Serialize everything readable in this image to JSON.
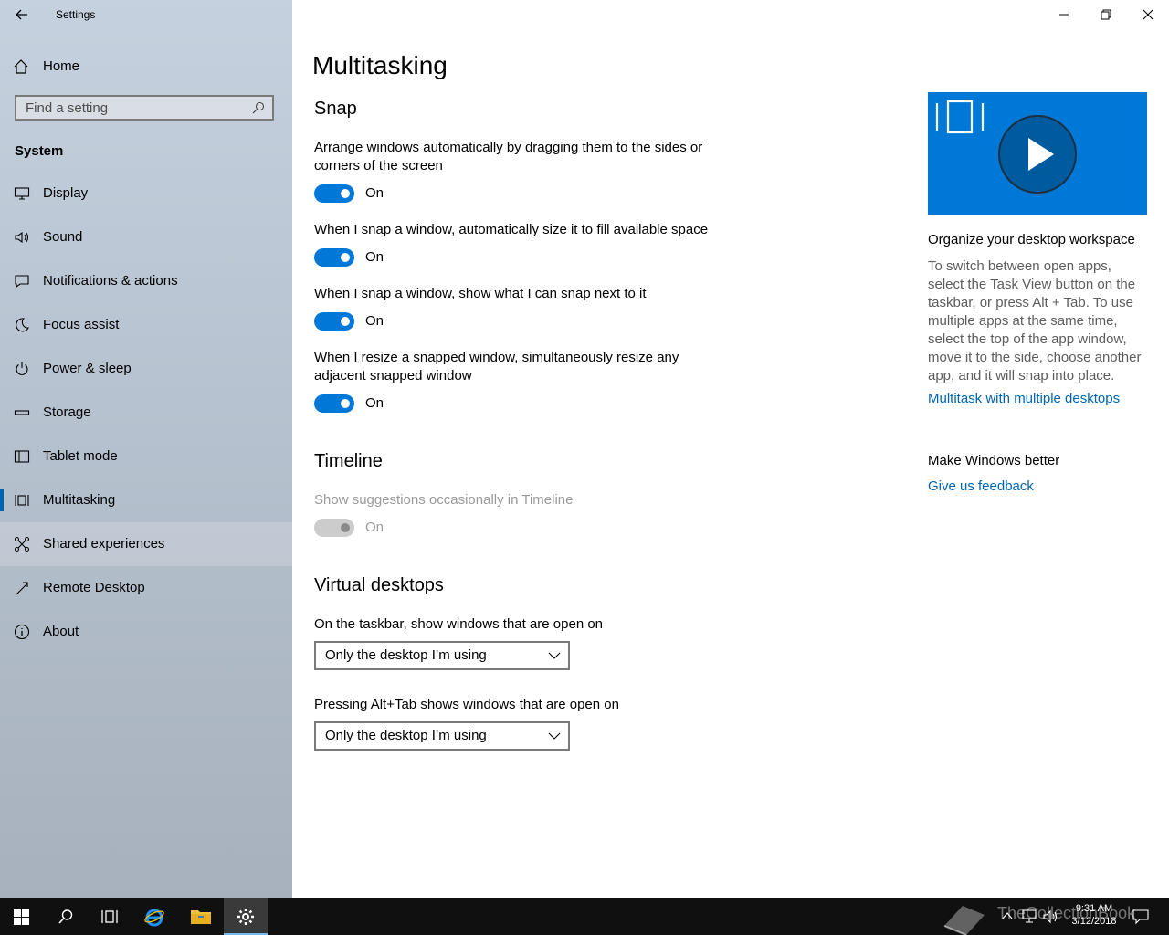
{
  "app": {
    "title": "Settings"
  },
  "sidebar": {
    "home_label": "Home",
    "search_placeholder": "Find a setting",
    "section": "System",
    "items": [
      {
        "label": "Display",
        "icon": "monitor-icon"
      },
      {
        "label": "Sound",
        "icon": "speaker-icon"
      },
      {
        "label": "Notifications & actions",
        "icon": "message-icon"
      },
      {
        "label": "Focus assist",
        "icon": "moon-icon"
      },
      {
        "label": "Power & sleep",
        "icon": "power-icon"
      },
      {
        "label": "Storage",
        "icon": "drive-icon"
      },
      {
        "label": "Tablet mode",
        "icon": "tablet-icon"
      },
      {
        "label": "Multitasking",
        "icon": "multitask-icon",
        "selected": true
      },
      {
        "label": "Shared experiences",
        "icon": "share-icon",
        "hovered": true
      },
      {
        "label": "Remote Desktop",
        "icon": "remote-icon"
      },
      {
        "label": "About",
        "icon": "info-icon"
      }
    ]
  },
  "main": {
    "title": "Multitasking",
    "snap": {
      "heading": "Snap",
      "settings": [
        {
          "label": "Arrange windows automatically by dragging them to the sides or corners of the screen",
          "state": "On"
        },
        {
          "label": "When I snap a window, automatically size it to fill available space",
          "state": "On"
        },
        {
          "label": "When I snap a window, show what I can snap next to it",
          "state": "On"
        },
        {
          "label": "When I resize a snapped window, simultaneously resize any adjacent snapped window",
          "state": "On"
        }
      ]
    },
    "timeline": {
      "heading": "Timeline",
      "label": "Show suggestions occasionally in Timeline",
      "state": "On"
    },
    "virtual_desktops": {
      "heading": "Virtual desktops",
      "taskbar_label": "On the taskbar, show windows that are open on",
      "taskbar_value": "Only the desktop I’m using",
      "alttab_label": "Pressing Alt+Tab shows windows that are open on",
      "alttab_value": "Only the desktop I’m using"
    }
  },
  "aside": {
    "video_title": "Organize your desktop workspace",
    "video_text": "To switch between open apps, select the Task View button on the taskbar, or press Alt + Tab. To use multiple apps at the same time, select the top of the app window, move it to the side, choose another app, and it will snap into place.",
    "video_link": "Multitask with multiple desktops",
    "feedback_title": "Make Windows better",
    "feedback_link": "Give us feedback"
  },
  "taskbar": {
    "time": "9:31 AM",
    "date": "3/12/2018",
    "watermark": "TheCollectionBook"
  },
  "colors": {
    "accent": "#0078d7",
    "link": "#0063b1",
    "taskbar": "#101010"
  }
}
